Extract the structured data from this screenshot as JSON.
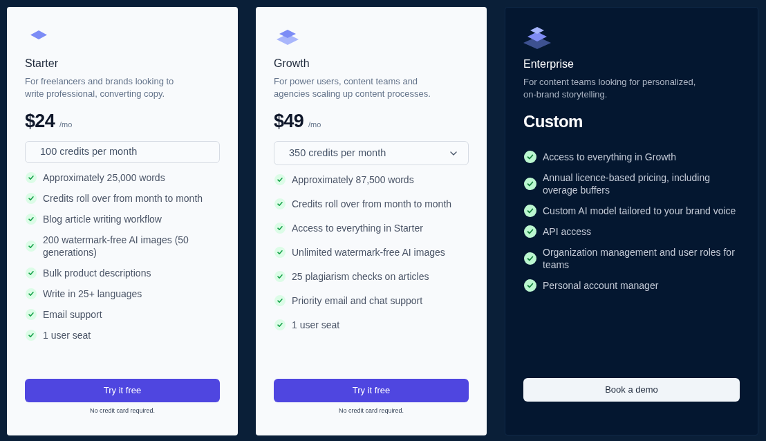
{
  "plans": [
    {
      "kind": "standard",
      "name": "Starter",
      "description": "For freelancers and brands looking to write professional, converting copy.",
      "price": "$24",
      "period": "/mo",
      "credits": {
        "kind": "field",
        "value": "100 credits per month"
      },
      "features": [
        "Approximately 25,000 words",
        "Credits roll over from month to month",
        "Blog article writing workflow",
        "200 watermark-free AI images (50 generations)",
        "Bulk product descriptions",
        "Write in 25+ languages",
        "Email support",
        "1 user seat"
      ],
      "button": {
        "label": "Try it free"
      },
      "note": "No credit card required."
    },
    {
      "kind": "standard",
      "name": "Growth",
      "description": "For power users, content teams and agencies scaling up content processes.",
      "price": "$49",
      "period": "/mo",
      "credits": {
        "kind": "dropdown",
        "value": "350 credits per month"
      },
      "features": [
        "Approximately 87,500 words",
        "Credits roll over from month to month",
        "Access to everything in Starter",
        "Unlimited watermark-free AI images",
        "25 plagiarism checks on articles",
        "Priority email and chat support",
        "1 user seat"
      ],
      "button": {
        "label": "Try it free"
      },
      "note": "No credit card required."
    },
    {
      "kind": "featured",
      "name": "Enterprise",
      "description": "For content teams looking for personalized, on-brand storytelling.",
      "price": "Custom",
      "features": [
        "Access to everything in Growth",
        "Annual licence-based pricing, including overage buffers",
        "Custom AI model tailored to your brand voice",
        "API access",
        "Organization management and user roles for teams",
        "Personal account manager"
      ],
      "button": {
        "label": "Book a demo"
      }
    }
  ]
}
